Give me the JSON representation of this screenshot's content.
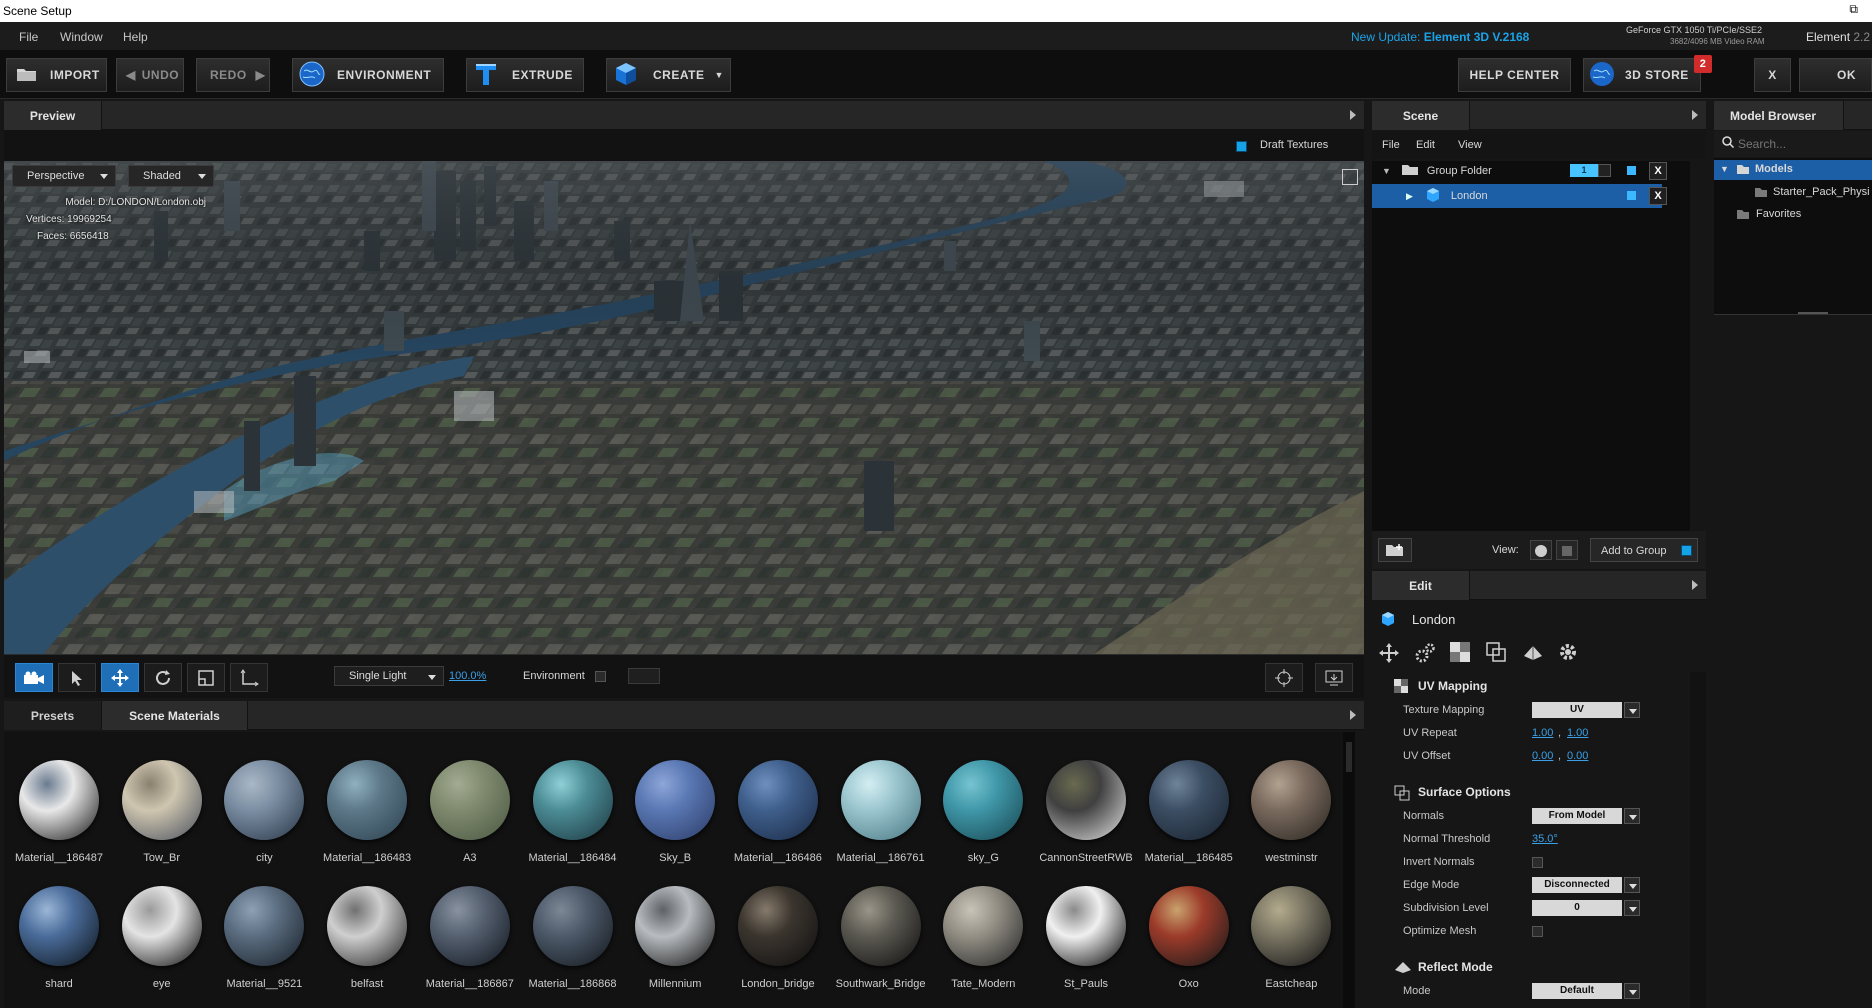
{
  "window": {
    "title": "Scene Setup",
    "restore_glyph": "⧉"
  },
  "menu": {
    "items": [
      "File",
      "Window",
      "Help"
    ],
    "update_prefix": "New Update:",
    "update_version": "Element 3D V.2168",
    "gpu_name": "GeForce GTX 1050 Ti/PCIe/SSE2",
    "gpu_mem": "3682/4096 MB Video RAM",
    "app_name": "Element",
    "app_version": "2.2"
  },
  "toolbar": {
    "import": "IMPORT",
    "undo": "UNDO",
    "redo": "REDO",
    "environment": "ENVIRONMENT",
    "extrude": "EXTRUDE",
    "create": "CREATE",
    "help_center": "HELP CENTER",
    "store": "3D STORE",
    "store_badge": "2",
    "close": "X",
    "ok": "OK"
  },
  "preview": {
    "tab": "Preview",
    "draft_textures": "Draft Textures",
    "camera": "Perspective",
    "shading": "Shaded",
    "info_labels": [
      "Model:",
      "Vertices:",
      "Faces:"
    ],
    "info_values": [
      "D:/LONDON/London.obj",
      "19969254",
      "6656418"
    ]
  },
  "viewport_tools": {
    "light_mode": "Single Light",
    "light_value": "100.0%",
    "environment": "Environment"
  },
  "materials": {
    "tabs": [
      "Presets",
      "Scene Materials"
    ],
    "row1": [
      "Material__186487",
      "Tow_Br",
      "city",
      "Material__186483",
      "A3",
      "Material__186484",
      "Sky_B",
      "Material__186486",
      "Material__186761",
      "sky_G",
      "CannonStreetRWB",
      "Material__186485",
      "westminstr"
    ],
    "row2": [
      "shard",
      "eye",
      "Material__9521",
      "belfast",
      "Material__186867",
      "Material__186868",
      "Millennium",
      "London_bridge",
      "Southwark_Bridge",
      "Tate_Modern",
      "St_Pauls",
      "Oxo",
      "Eastcheap"
    ]
  },
  "scene": {
    "tab": "Scene",
    "menu": [
      "File",
      "Edit",
      "View"
    ],
    "group_folder": "Group Folder",
    "group_count": "1",
    "child": "London",
    "view_label": "View:",
    "add_to_group": "Add to Group"
  },
  "model_browser": {
    "tab": "Model Browser",
    "search_placeholder": "Search...",
    "models": "Models",
    "starter": "Starter_Pack_Physi",
    "favorites": "Favorites"
  },
  "edit": {
    "tab": "Edit",
    "object": "London",
    "uv_section": "UV Mapping",
    "texture_mapping_label": "Texture Mapping",
    "texture_mapping_value": "UV",
    "uv_repeat_label": "UV Repeat",
    "uv_repeat": [
      "1.00",
      "1.00"
    ],
    "uv_offset_label": "UV Offset",
    "uv_offset": [
      "0.00",
      "0.00"
    ],
    "surface_section": "Surface Options",
    "normals_label": "Normals",
    "normals_value": "From Model",
    "normal_threshold_label": "Normal Threshold",
    "normal_threshold": "35.0°",
    "invert_normals_label": "Invert Normals",
    "edge_mode_label": "Edge Mode",
    "edge_mode_value": "Disconnected",
    "subdivision_label": "Subdivision Level",
    "subdivision_value": "0",
    "optimize_label": "Optimize Mesh",
    "reflect_section": "Reflect Mode",
    "mode_label": "Mode",
    "mode_value": "Default"
  }
}
